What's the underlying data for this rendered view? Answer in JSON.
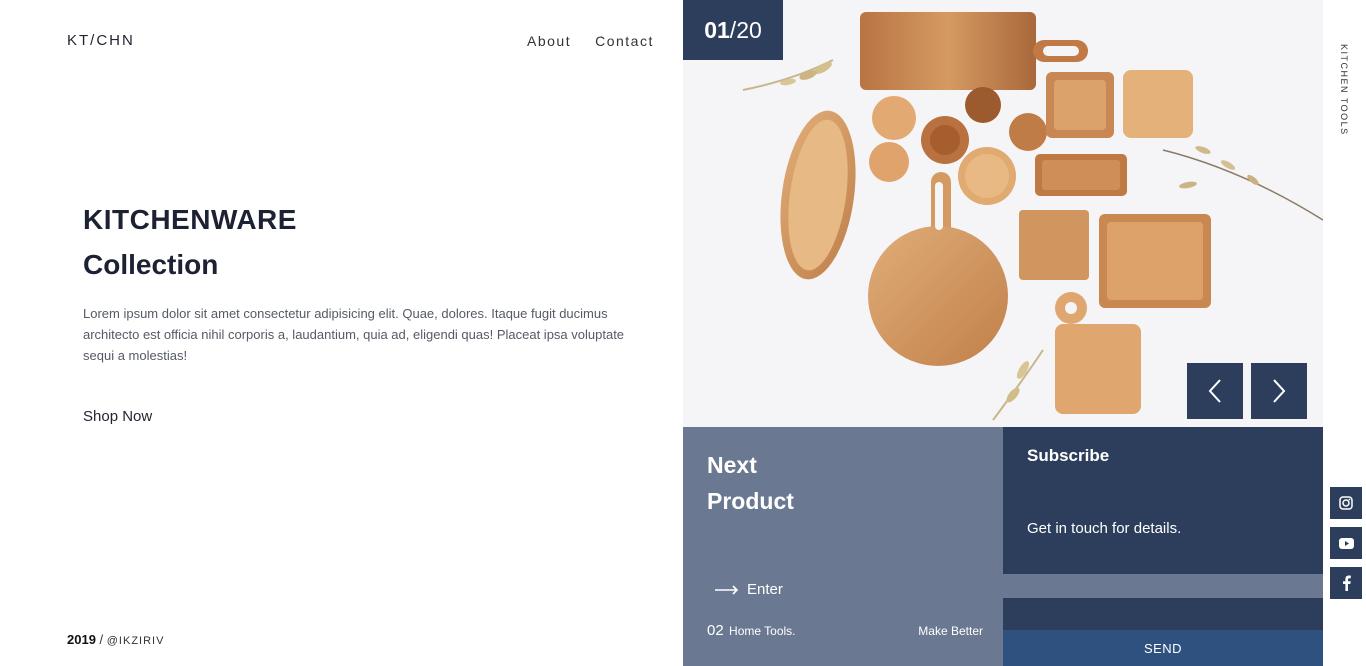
{
  "brand": {
    "logo": "KT/CHN"
  },
  "nav": {
    "items": [
      "About",
      "Contact"
    ]
  },
  "hero": {
    "title_line1": "KITCHENWARE",
    "title_line2": "Collection",
    "description": "Lorem ipsum dolor sit amet consectetur adipisicing elit. Quae, dolores. Itaque fugit ducimus architecto est officia nihil corporis a, laudantium, quia ad, eligendi quas! Placeat ipsa voluptate sequi a molestias!",
    "cta": "Shop Now"
  },
  "footer": {
    "year": "2019",
    "separator": " / ",
    "handle": "@IKZIRIV"
  },
  "slider": {
    "current": "01",
    "separator": " / ",
    "total": "20",
    "side_label": "KITCHEN TOOLS"
  },
  "next_product": {
    "title_line1": "Next",
    "title_line2": "Product",
    "enter_label": "Enter",
    "number": "02",
    "name": "Home Tools.",
    "tagline": "Make Better"
  },
  "subscribe": {
    "title": "Subscribe",
    "text": "Get in touch for details.",
    "input_placeholder": "",
    "send_label": "SEND"
  },
  "social": [
    "instagram-icon",
    "youtube-icon",
    "facebook-icon"
  ],
  "colors": {
    "navy": "#2c3e5c",
    "slate": "#6b7891",
    "send": "#2f5180"
  }
}
